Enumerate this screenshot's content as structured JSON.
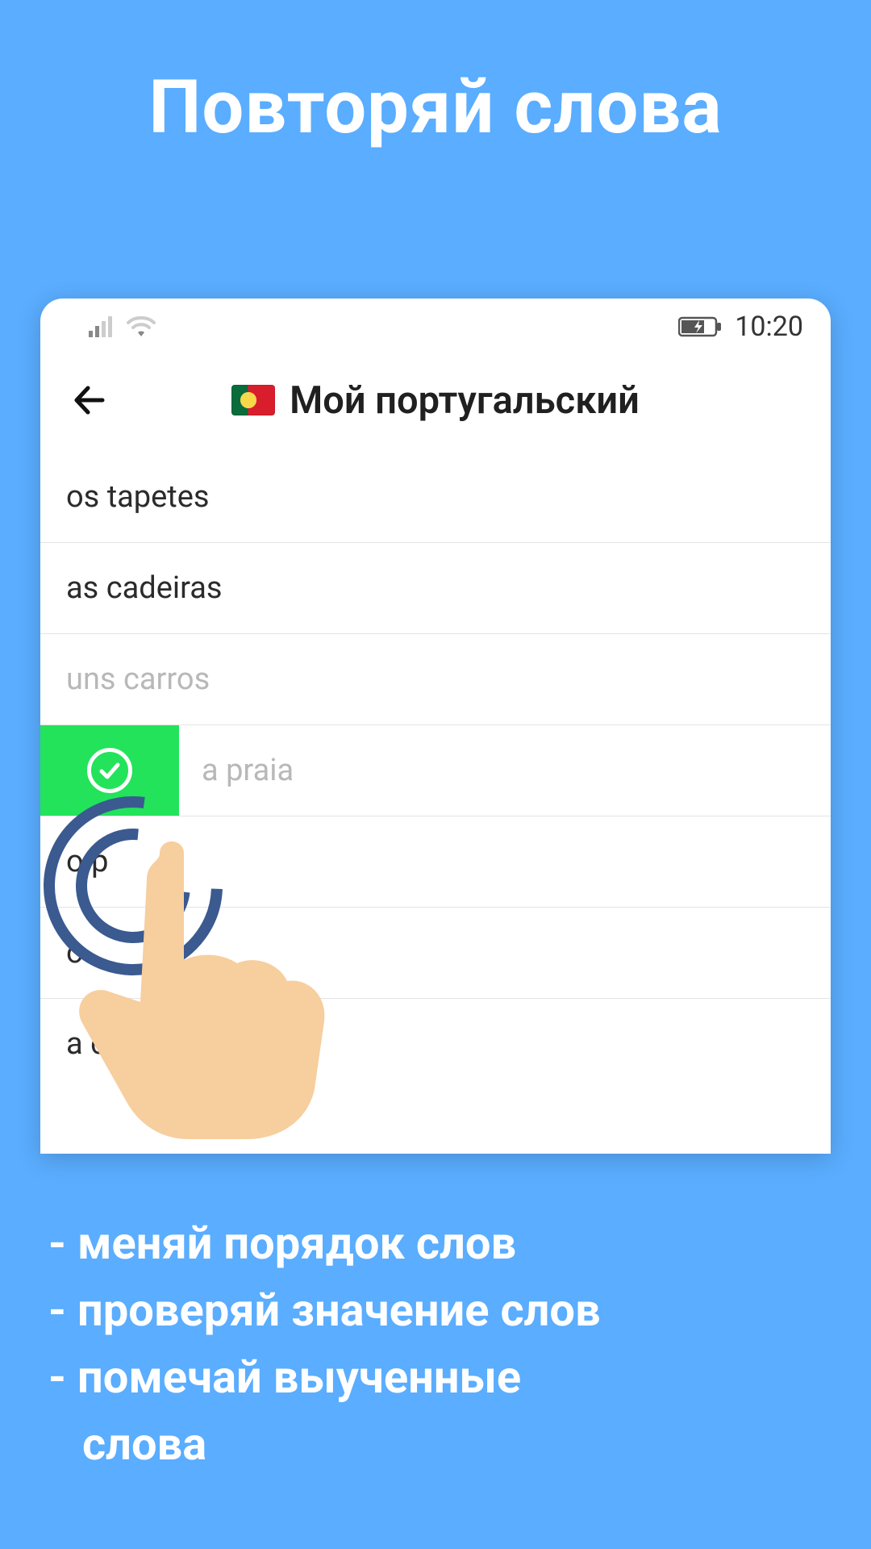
{
  "promo": {
    "title": "Повторяй слова",
    "bullets": [
      "- меняй порядок слов",
      "- проверяй значение слов",
      "- помечай выученные",
      "  слова"
    ]
  },
  "status": {
    "time": "10:20"
  },
  "header": {
    "title": "Мой португальский",
    "flag_country": "portugal"
  },
  "words": [
    {
      "text": "os tapetes",
      "faded": false,
      "swiped": false
    },
    {
      "text": "as cadeiras",
      "faded": false,
      "swiped": false
    },
    {
      "text": "uns carros",
      "faded": true,
      "swiped": false
    },
    {
      "text": "a praia",
      "faded": true,
      "swiped": true
    },
    {
      "text": "o p",
      "faded": false,
      "swiped": false
    },
    {
      "text": "o",
      "faded": false,
      "swiped": false
    },
    {
      "text": "a cidade",
      "faded": false,
      "swiped": false
    }
  ],
  "colors": {
    "background": "#5aadff",
    "swipe_action": "#22e35a",
    "hand": "#f7ce9e",
    "hand_ring": "#3a5a90"
  }
}
